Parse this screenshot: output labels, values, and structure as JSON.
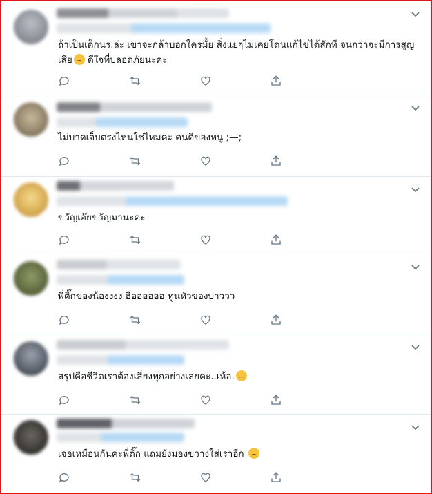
{
  "tweets": [
    {
      "id": "t1",
      "text": "ถ้าเป็นเด็กนร.ล่ะ เขาจะกล้าบอกใครมั้ย สิ่งแย่ๆไม่เคยโดนแก้ไขได้สักที จนกว่าจะมีการสูญเสีย",
      "text_after": " ดีใจที่ปลอดภัยนะคะ",
      "emoji": "sad-emoji",
      "avatar_color": "#8a8f98"
    },
    {
      "id": "t2",
      "text": "ไม่บาดเจ็บตรงไหนใช่ไหมคะ คนดีของหนู ;—;",
      "text_after": "",
      "emoji": "",
      "avatar_color": "#9c8a6e"
    },
    {
      "id": "t3",
      "text": "ขวัญเอ๊ยขวัญมานะคะ",
      "text_after": "",
      "emoji": "",
      "avatar_color": "#e8b04a"
    },
    {
      "id": "t4",
      "text": "พี่ติ๊กของน้องงงง ฮืออออออ ทูนหัวของบ่าววว",
      "text_after": "",
      "emoji": "",
      "avatar_color": "#5e6b3e"
    },
    {
      "id": "t5",
      "text": "สรุปคือชีวิตเราต้องเสี่ยงทุกอย่างเลยคะ..เห้อ.",
      "text_after": "",
      "emoji": "sad-emoji",
      "avatar_color": "#3e4552"
    },
    {
      "id": "t6",
      "text": "เจอเหมือนกันค่ะพี่ติ๊ก แถมยังมองขวางใส่เราอีก",
      "text_after": "",
      "emoji": "smirk-emoji",
      "avatar_color": "#2b2a28"
    }
  ],
  "icons": {
    "reply": "reply-icon",
    "retweet": "retweet-icon",
    "like": "heart-icon",
    "share": "share-icon",
    "menu": "chevron-down-icon"
  },
  "colors": {
    "text": "#14171a",
    "icon": "#657786",
    "divider": "#e1e8ed",
    "frame": "#e0141e",
    "blurred_link": "#9fcdf2"
  }
}
